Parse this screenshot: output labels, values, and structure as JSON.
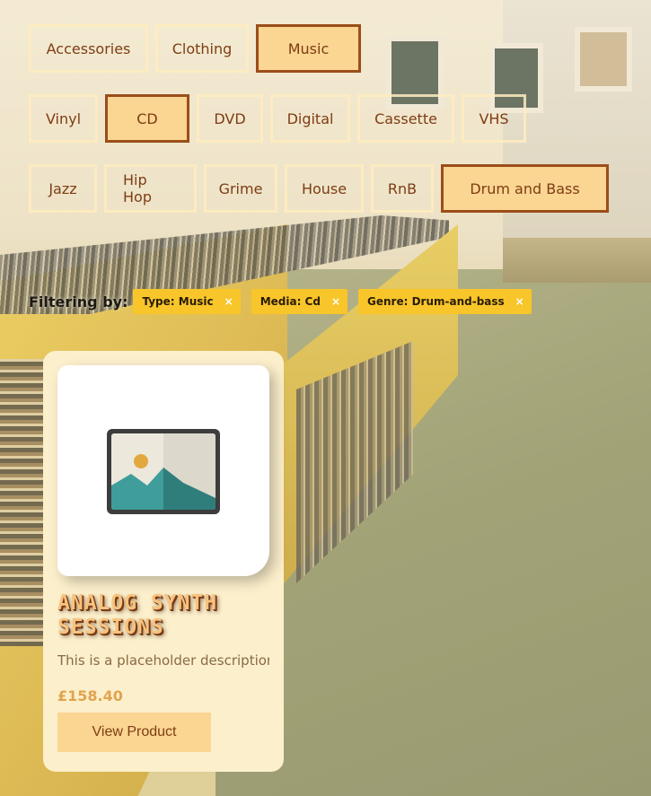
{
  "filters": {
    "type_row": [
      {
        "label": "Accessories",
        "active": false
      },
      {
        "label": "Clothing",
        "active": false
      },
      {
        "label": "Music",
        "active": true
      }
    ],
    "media_row": [
      {
        "label": "Vinyl",
        "active": false
      },
      {
        "label": "CD",
        "active": true
      },
      {
        "label": "DVD",
        "active": false
      },
      {
        "label": "Digital",
        "active": false
      },
      {
        "label": "Cassette",
        "active": false
      },
      {
        "label": "VHS",
        "active": false
      }
    ],
    "genre_row": [
      {
        "label": "Jazz",
        "active": false
      },
      {
        "label": "Hip Hop",
        "active": false
      },
      {
        "label": "Grime",
        "active": false
      },
      {
        "label": "House",
        "active": false
      },
      {
        "label": "RnB",
        "active": false
      },
      {
        "label": "Drum and Bass",
        "active": true
      }
    ]
  },
  "filtering": {
    "label": "Filtering by:",
    "chips": [
      {
        "label": "Type: Music",
        "remove": "×"
      },
      {
        "label": "Media: Cd",
        "remove": "×"
      },
      {
        "label": "Genre: Drum-and-bass",
        "remove": "×"
      }
    ]
  },
  "product": {
    "title": "Analog Synth Sessions",
    "description": "This is a placeholder description",
    "price": "£158.40",
    "button_label": "View Product",
    "image_icon": "image-placeholder-icon"
  },
  "colors": {
    "pill_active_bg": "#fbd592",
    "pill_active_border": "#9a4e1a",
    "pill_text": "#7d3d14",
    "chip_bg": "#f8c62a",
    "card_bg": "#fcefcb",
    "price": "#e1a34e"
  }
}
